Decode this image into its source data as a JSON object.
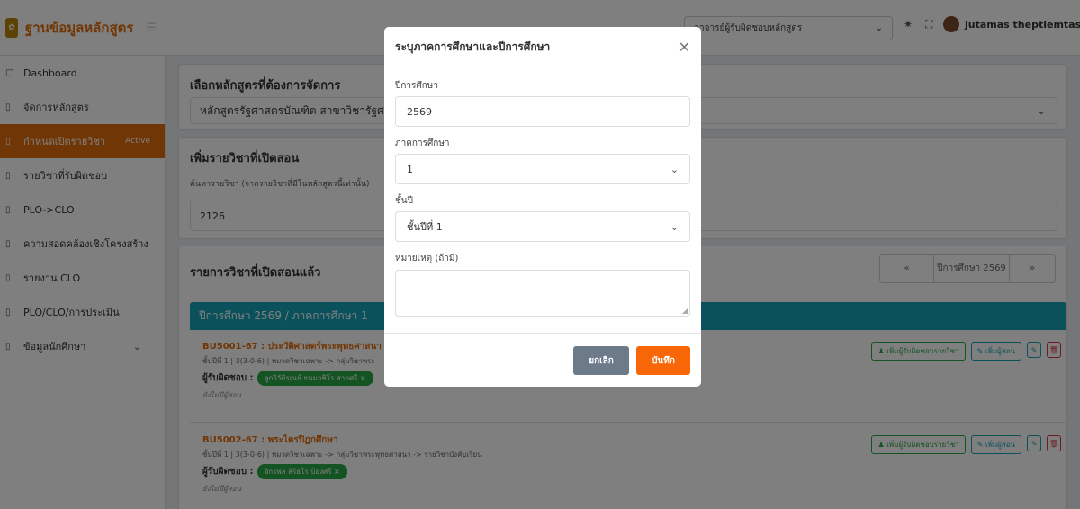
{
  "header": {
    "brand_title": "ฐานข้อมูลหลักสูตร",
    "role_selected": "อาจารย์ผู้รับผิดชอบหลักสูตร",
    "user_name": "jutamas theptiemtas"
  },
  "sidebar": {
    "items": [
      {
        "label": "Dashboard"
      },
      {
        "label": "จัดการหลักสูตร"
      },
      {
        "label": "กำหนดเปิดรายวิชา",
        "badge": "Active"
      },
      {
        "label": "รายวิชาที่รับผิดชอบ"
      },
      {
        "label": "PLO->CLO"
      },
      {
        "label": "ความสอดคล้องเชิงโครงสร้าง"
      },
      {
        "label": "รายงาน CLO"
      },
      {
        "label": "PLO/CLO/การประเมิน"
      },
      {
        "label": "ข้อมูลนักศึกษา"
      }
    ]
  },
  "main": {
    "select_title": "เลือกหลักสูตรที่ต้องการจัดการ",
    "select_value": "หลักสูตรรัฐศาสตรบัณฑิต สาขาวิชารัฐศ",
    "add_title": "เพิ่มรายวิชาที่เปิดสอน",
    "search_label": "ค้นหารายวิชา (จากรายวิชาที่มีในหลักสูตรนี้เท่านั้น)",
    "search_value": "2126",
    "list_title": "รายการวิชาที่เปิดสอนแล้ว",
    "pager_prev": "«",
    "pager_label": "ปีการศึกษา 2569",
    "pager_next": "»",
    "term_bar": "ปีการศึกษา 2569 / ภาคการศึกษา 1",
    "add_responsible_btn": "เพิ่มผู้รับผิดชอบรายวิชา",
    "add_teacher_btn": "เพิ่มผู้สอน",
    "courses": [
      {
        "code": "BU5001-67 : ประวัติศาสตร์พระพุทธศาสนา",
        "meta": "ชั้นปีที่ 1 | 3(3-0-6) | หมวดวิชาเฉพาะ -> กลุ่มวิชาพระ",
        "resp_label": "ผู้รับผิดชอบ :",
        "resp_name": "ลูกวิวัติรเนย์ ธนมวชิโร สายศรี",
        "no_teacher": "ยังไม่มีผู้สอน"
      },
      {
        "code": "BU5002-67 : พระไตรปิฎกศึกษา",
        "meta": "ชั้นปีที่ 1 | 3(3-0-6) | หมวดวิชาเฉพาะ -> กลุ่มวิชาพระพุทธศาสนา -> รายวิชาบังคับเรียน",
        "resp_label": "ผู้รับผิดชอบ :",
        "resp_name": "จักรพล สิริธโร ป้องศรี",
        "no_teacher": "ยังไม่มีผู้สอน"
      }
    ]
  },
  "modal": {
    "title": "ระบุภาคการศึกษาและปีการศึกษา",
    "year_label": "ปีการศึกษา",
    "year_value": "2569",
    "term_label": "ภาคการศึกษา",
    "term_value": "1",
    "grade_label": "ชั้นปี",
    "grade_value": "ชั้นปีที่ 1",
    "note_label": "หมายเหตุ (ถ้ามี)",
    "note_value": "",
    "cancel_label": "ยกเลิก",
    "save_label": "บันทึก"
  }
}
